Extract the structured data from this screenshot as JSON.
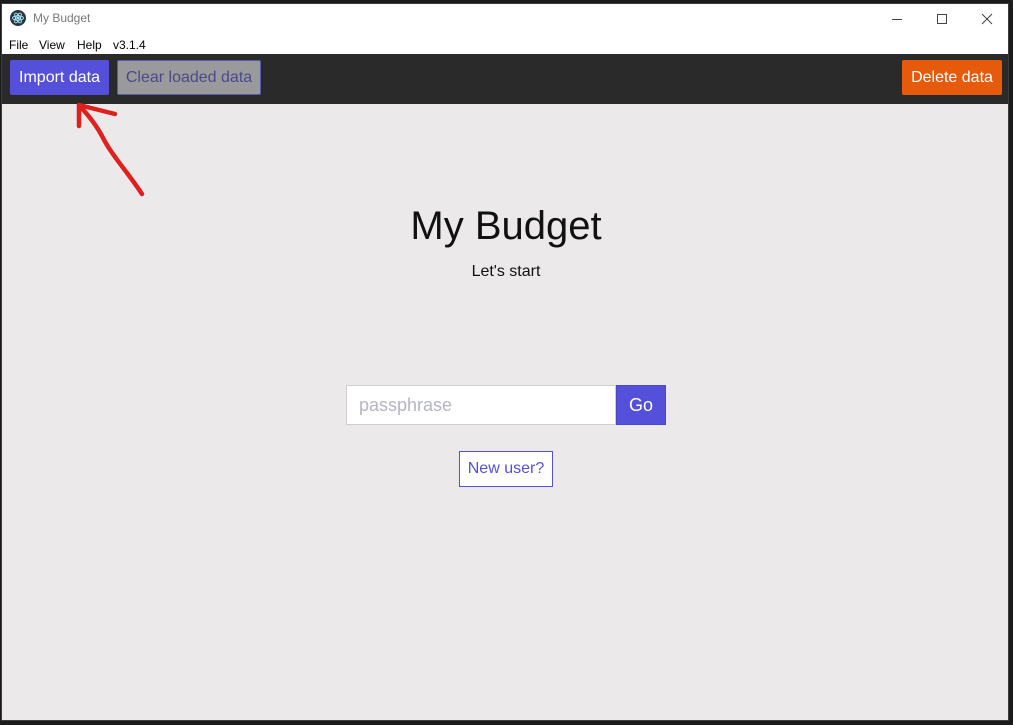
{
  "window": {
    "title": "My Budget",
    "icon": "electron-app-icon"
  },
  "menubar": {
    "items": [
      "File",
      "View",
      "Help"
    ],
    "version": "v3.1.4"
  },
  "toolbar": {
    "import_label": "Import data",
    "clear_label": "Clear loaded data",
    "delete_label": "Delete data"
  },
  "main": {
    "title": "My Budget",
    "subtitle": "Let's start",
    "passphrase_placeholder": "passphrase",
    "passphrase_value": "",
    "go_label": "Go",
    "new_user_label": "New user?"
  },
  "colors": {
    "accent": "#5450d9",
    "danger": "#e65a0b",
    "toolbar_bg": "#2a2a2a",
    "page_bg": "#ebe9ea",
    "annotation": "#e0201e"
  }
}
